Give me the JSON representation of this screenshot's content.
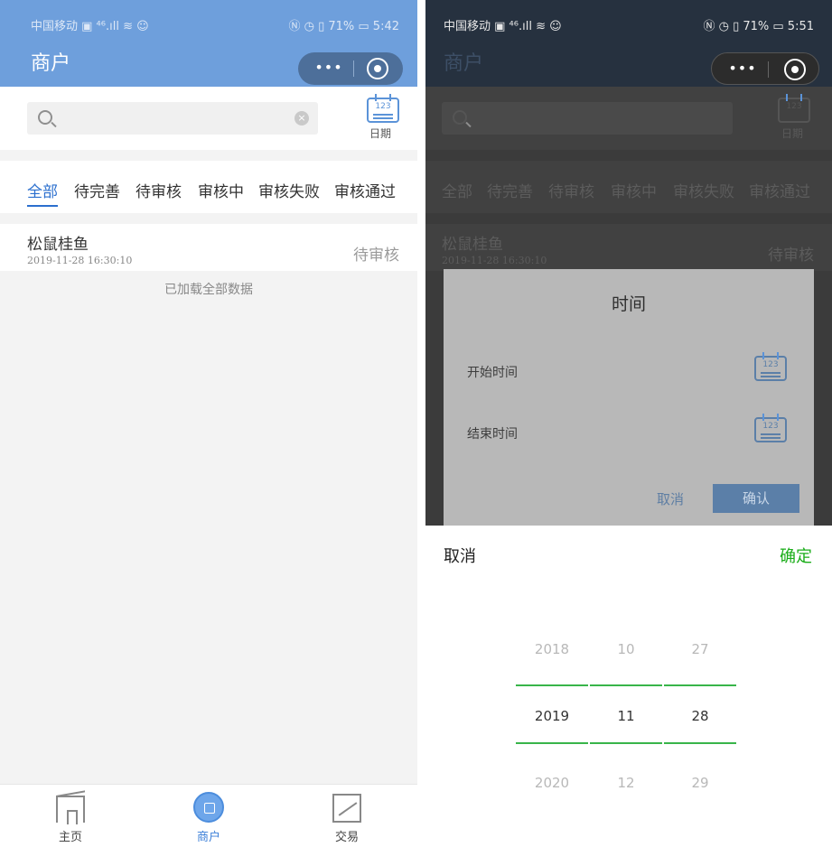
{
  "left": {
    "status_left": "中国移动 ▣ ⁴⁶.ıll ≋ ☺",
    "status_right": "Ⓝ ◷ ▯ 71% ▭ 5:42",
    "title": "商户",
    "capsule_more": "•••",
    "date_label": "日期",
    "calendar_number": "123",
    "tabs": [
      "全部",
      "待完善",
      "待审核",
      "审核中",
      "审核失败",
      "审核通过"
    ],
    "active_tab": "全部",
    "row": {
      "title": "松鼠桂鱼",
      "time": "2019-11-28 16:30:10",
      "status": "待审核"
    },
    "load_note": "已加载全部数据",
    "tabbar": [
      {
        "label": "主页",
        "icon": "home-icon"
      },
      {
        "label": "商户",
        "icon": "shop-icon"
      },
      {
        "label": "交易",
        "icon": "trade-icon"
      }
    ],
    "colors": {
      "header": "#6e9fdc",
      "accent": "#2b6fce"
    }
  },
  "right": {
    "status_left": "中国移动 ▣ ⁴⁶.ıll ≋ ☺",
    "status_right": "Ⓝ ◷ ▯ 71% ▭ 5:51",
    "title": "商户",
    "capsule_more": "•••",
    "date_label": "日期",
    "calendar_number": "123",
    "tabs": [
      "全部",
      "待完善",
      "待审核",
      "审核中",
      "审核失败",
      "审核通过"
    ],
    "row": {
      "title": "松鼠桂鱼",
      "time": "2019-11-28 16:30:10",
      "status": "待审核"
    },
    "modal": {
      "title": "时间",
      "start_label": "开始时间",
      "end_label": "结束时间",
      "cancel": "取消",
      "confirm": "确认"
    },
    "picker": {
      "cancel": "取消",
      "confirm": "确定",
      "rows": [
        {
          "year": "2018",
          "month": "10",
          "day": "27"
        },
        {
          "year": "2019",
          "month": "11",
          "day": "28"
        },
        {
          "year": "2020",
          "month": "12",
          "day": "29"
        }
      ],
      "selected_index": 1,
      "confirm_color": "#1aad19"
    }
  }
}
